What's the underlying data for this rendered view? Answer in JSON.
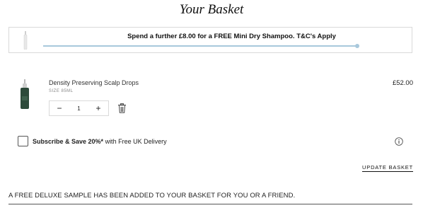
{
  "page": {
    "title": "Your Basket"
  },
  "promo": {
    "message": "Spend a further £8.00 for a FREE Mini Dry Shampoo. T&C's Apply",
    "progress": 1.0,
    "thumb_icon": "dry-shampoo-thumbnail"
  },
  "item": {
    "name": "Density Preserving Scalp Drops",
    "size": "SIZE 85ML",
    "price": "£52.00",
    "quantity": "1",
    "decrement_label": "−",
    "increment_label": "+",
    "image_icon": "scalp-drops-bottle",
    "remove_icon": "trash-icon"
  },
  "subscribe": {
    "label_bold": "Subscribe & Save 20%*",
    "label_rest": " with Free UK Delivery",
    "checked": false,
    "info_icon": "info-icon"
  },
  "actions": {
    "update_label": "UPDATE BASKET"
  },
  "sample": {
    "message": "A FREE DELUXE SAMPLE HAS BEEN ADDED TO YOUR BASKET FOR YOU OR A FRIEND."
  },
  "colors": {
    "progress": "#a8c8dc",
    "border": "#d9d9d9",
    "bottle": "#2d4a3a"
  }
}
